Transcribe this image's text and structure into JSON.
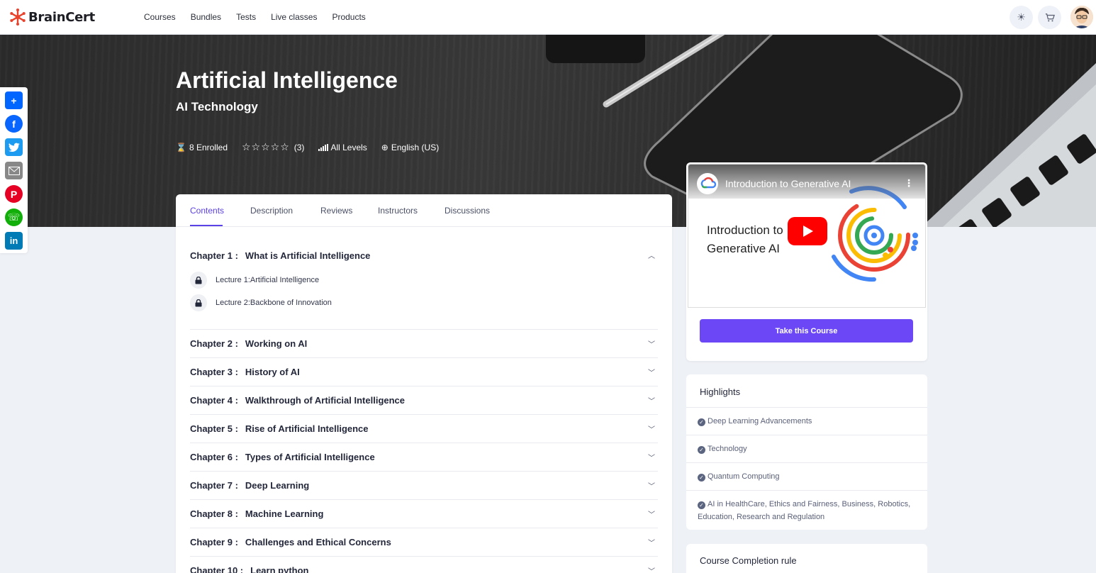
{
  "brand": {
    "name": "BrainCert",
    "accent": "#e8432c"
  },
  "nav": {
    "items": [
      "Courses",
      "Bundles",
      "Tests",
      "Live classes",
      "Products"
    ]
  },
  "header_icons": [
    "sun-icon",
    "cart-icon"
  ],
  "hero": {
    "title": "Artificial Intelligence",
    "subtitle": "AI Technology",
    "enrolled": "8 Enrolled",
    "rating_count": "(3)",
    "stars": "☆☆☆☆☆",
    "level": "All Levels",
    "language": "English (US)"
  },
  "share": [
    "share-icon",
    "facebook-icon",
    "twitter-icon",
    "email-icon",
    "pinterest-icon",
    "whatsapp-icon",
    "linkedin-icon"
  ],
  "tabs": [
    "Contents",
    "Description",
    "Reviews",
    "Instructors",
    "Discussions"
  ],
  "chapters": [
    {
      "num": "Chapter 1 :",
      "title": "What is Artificial Intelligence"
    },
    {
      "num": "Chapter 2 :",
      "title": "Working on AI"
    },
    {
      "num": "Chapter 3 :",
      "title": "History of AI"
    },
    {
      "num": "Chapter 4 :",
      "title": "Walkthrough of Artificial Intelligence"
    },
    {
      "num": "Chapter 5 :",
      "title": "Rise of Artificial Intelligence"
    },
    {
      "num": "Chapter 6 :",
      "title": "Types of Artificial Intelligence"
    },
    {
      "num": "Chapter 7 :",
      "title": "Deep Learning"
    },
    {
      "num": "Chapter 8 :",
      "title": "Machine Learning"
    },
    {
      "num": "Chapter 9 :",
      "title": "Challenges and Ethical Concerns"
    },
    {
      "num": "Chapter 10 :",
      "title": "Learn python"
    }
  ],
  "lectures": [
    "Lecture 1:Artificial Intelligence",
    "Lecture 2:Backbone of Innovation"
  ],
  "video": {
    "title": "Introduction to Generative AI",
    "big_line1": "Introduction to",
    "big_line2": "Generative AI",
    "channel": "google cloud"
  },
  "cta": {
    "label": "Take this Course",
    "color": "#6b47f6"
  },
  "highlights": {
    "heading": "Highlights",
    "items": [
      "Deep Learning Advancements",
      "Technology",
      "Quantum Computing",
      "AI in HealthCare, Ethics and Fairness, Business, Robotics, Education, Research and Regulation"
    ]
  },
  "completion": {
    "heading": "Course Completion rule"
  }
}
